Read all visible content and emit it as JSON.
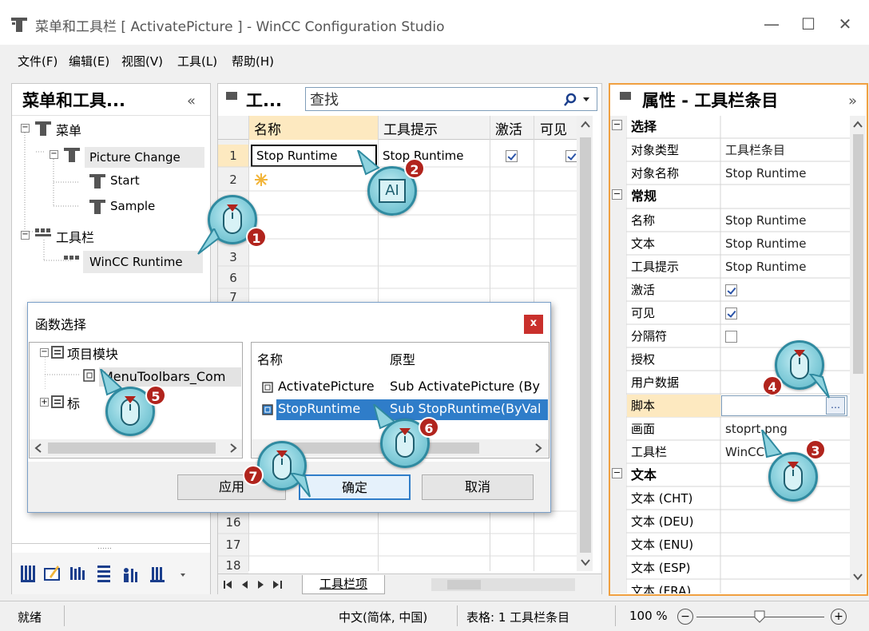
{
  "window": {
    "title": "菜单和工具栏 [ ActivatePicture ] - WinCC Configuration Studio",
    "minimize": "—",
    "maximize": "☐",
    "close": "✕"
  },
  "menubar": [
    "文件(F)",
    "编辑(E)",
    "视图(V)",
    "工具(L)",
    "帮助(H)"
  ],
  "left_panel": {
    "title": "菜单和工具...",
    "collapse": "«",
    "tree": {
      "menu": "菜单",
      "picture_change": "Picture Change",
      "start": "Start",
      "sample": "Sample",
      "toolbar": "工具栏",
      "wincc_runtime": "WinCC Runtime"
    },
    "dots": "……"
  },
  "mid_panel": {
    "title": "工...",
    "search_placeholder": "查找",
    "columns": [
      "名称",
      "工具提示",
      "激活",
      "可见"
    ],
    "row1": {
      "num": "1",
      "name": "Stop Runtime",
      "tooltip": "Stop Runtime",
      "active": true,
      "visible": true
    },
    "row_numbers": [
      "2",
      "3",
      "6",
      "7",
      "16",
      "17",
      "18"
    ],
    "sheet_tab": "工具栏项"
  },
  "right_panel": {
    "title": "属性 - 工具栏条目",
    "expand": "»",
    "sections": {
      "select": "选择",
      "general": "常规",
      "text": "文本"
    },
    "props": [
      {
        "name": "对象类型",
        "value": "工具栏条目"
      },
      {
        "name": "对象名称",
        "value": "Stop Runtime"
      },
      {
        "name": "名称",
        "value": "Stop Runtime"
      },
      {
        "name": "文本",
        "value": "Stop Runtime"
      },
      {
        "name": "工具提示",
        "value": "Stop Runtime"
      },
      {
        "name": "激活",
        "value": ""
      },
      {
        "name": "可见",
        "value": ""
      },
      {
        "name": "分隔符",
        "value": ""
      },
      {
        "name": "授权",
        "value": ""
      },
      {
        "name": "用户数据",
        "value": ""
      },
      {
        "name": "脚本",
        "value": ""
      },
      {
        "name": "画面",
        "value": "stoprt.png"
      },
      {
        "name": "工具栏",
        "value": "WinCC"
      }
    ],
    "text_props": [
      "文本 (CHT)",
      "文本 (DEU)",
      "文本 (ENU)",
      "文本 (ESP)",
      "文本 (FRA)"
    ],
    "browse": "…"
  },
  "dialog": {
    "title": "函数选择",
    "close": "x",
    "tree": {
      "project_module": "项目模块",
      "file": "MenuToolbars_Com",
      "std": "标"
    },
    "list_headers": [
      "名称",
      "原型"
    ],
    "items": [
      {
        "name": "ActivatePicture",
        "proto": "Sub ActivatePicture (By"
      },
      {
        "name": "StopRuntime",
        "proto": "Sub StopRuntime(ByVal"
      }
    ],
    "apply": "应用",
    "ok": "确定",
    "cancel": "取消"
  },
  "cursors": {
    "b1": "1",
    "b2": "2",
    "b3": "3",
    "b4": "4",
    "b5": "5",
    "b6": "6",
    "b7": "7",
    "text_cursor": "AI"
  },
  "statusbar": {
    "ready": "就绪",
    "lang": "中文(简体, 中国)",
    "table": "表格: 1 工具栏条目",
    "zoom": "100 %",
    "minus": "−",
    "plus": "+"
  },
  "colors": {
    "accent_orange": "#f0a040",
    "selection_blue": "#2f7dc9",
    "badge_red": "#b1241d",
    "cursor_teal": "#8fd3df"
  }
}
